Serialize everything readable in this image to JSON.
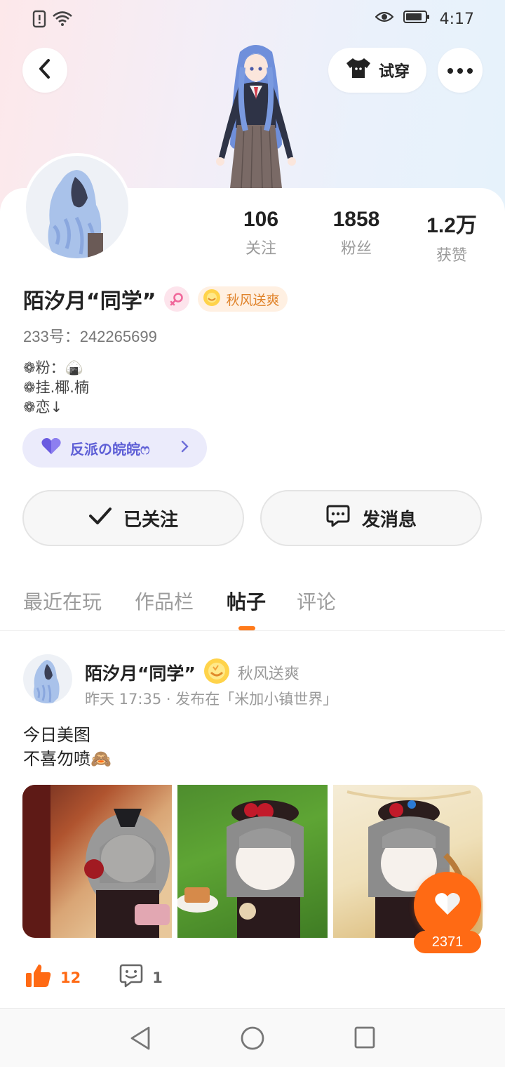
{
  "status_bar": {
    "time": "4:17",
    "icons": [
      "sim-alert-icon",
      "wifi-icon",
      "eye-icon",
      "battery-icon"
    ]
  },
  "header": {
    "try_on_label": "试穿",
    "icons": [
      "back-icon",
      "tshirt-icon",
      "more-icon"
    ]
  },
  "profile": {
    "stats": [
      {
        "value": "106",
        "label": "关注"
      },
      {
        "value": "1858",
        "label": "粉丝"
      },
      {
        "value": "1.2万",
        "label": "获赞"
      }
    ],
    "username": "陌汐月“同学”",
    "gender": "female",
    "title_badge": "秋风送爽",
    "uid": "233号：242265699",
    "bio_lines": [
      "❁粉：🍙",
      "❁挂.椰.楠",
      "❁恋↓"
    ],
    "group_pill": "反派の皖皖ෆ"
  },
  "actions": {
    "follow_label": "已关注",
    "message_label": "发消息"
  },
  "tabs": [
    {
      "label": "最近在玩",
      "active": false
    },
    {
      "label": "作品栏",
      "active": false
    },
    {
      "label": "帖子",
      "active": true
    },
    {
      "label": "评论",
      "active": false
    }
  ],
  "post": {
    "author": "陌汐月“同学”",
    "author_title": "秋风送爽",
    "meta": "昨天 17:35 · 发布在「米加小镇世界」",
    "text_lines": [
      "今日美图",
      "不喜勿喷🙈"
    ],
    "likes": "12",
    "comments": "1"
  },
  "floating_like": {
    "count": "2371"
  },
  "colors": {
    "accent": "#ff6a14",
    "purple": "#5e5fd6",
    "badge_orange": "#e0832a"
  }
}
